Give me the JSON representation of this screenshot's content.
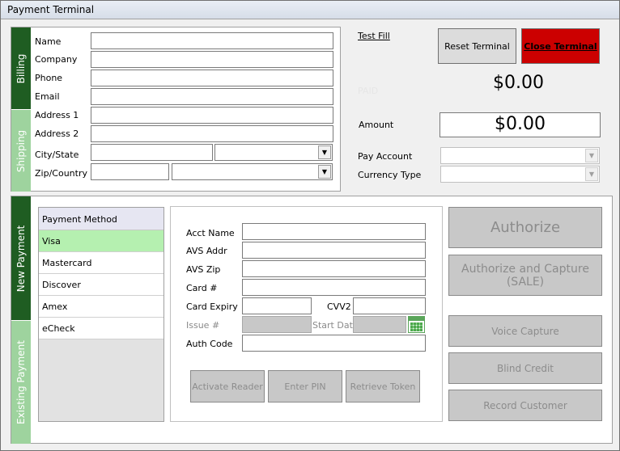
{
  "window": {
    "title": "Payment Terminal"
  },
  "tabs": {
    "billing": "Billing",
    "shipping": "Shipping",
    "new_payment": "New Payment",
    "existing_payment": "Existing Payment"
  },
  "billing": {
    "name_label": "Name",
    "company_label": "Company",
    "phone_label": "Phone",
    "email_label": "Email",
    "address1_label": "Address 1",
    "address2_label": "Address 2",
    "city_state_label": "City/State",
    "zip_country_label": "Zip/Country"
  },
  "header": {
    "test_fill": "Test Fill",
    "reset_terminal": "Reset Terminal",
    "close_terminal": "Close Terminal",
    "paid_label": "PAID",
    "paid_amount": "$0.00",
    "amount_label": "Amount",
    "amount_value": "$0.00",
    "pay_account_label": "Pay Account",
    "currency_type_label": "Currency Type"
  },
  "payment_method": {
    "header": "Payment Method",
    "items": [
      "Visa",
      "Mastercard",
      "Discover",
      "Amex",
      "eCheck"
    ],
    "selected": "Visa"
  },
  "card_form": {
    "acct_name": "Acct Name",
    "avs_addr": "AVS Addr",
    "avs_zip": "AVS Zip",
    "card_num": "Card #",
    "card_expiry": "Card Expiry",
    "cvv2": "CVV2",
    "issue_num": "Issue #",
    "start_date": "Start Date",
    "auth_code": "Auth Code",
    "activate_reader": "Activate Reader",
    "enter_pin": "Enter PIN",
    "retrieve_token": "Retrieve Token"
  },
  "actions": {
    "authorize": "Authorize",
    "authorize_capture": "Authorize and Capture (SALE)",
    "voice_capture": "Voice Capture",
    "blind_credit": "Blind Credit",
    "record_customer": "Record Customer"
  },
  "colors": {
    "tab_dark": "#1f5d22",
    "tab_light": "#9ed39e",
    "close_red": "#cc0000",
    "selected_row": "#b5f0b0"
  }
}
